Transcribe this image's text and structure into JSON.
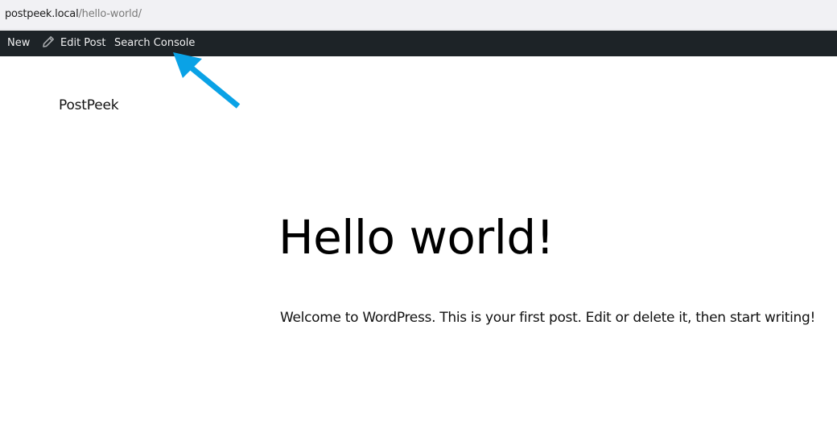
{
  "browser": {
    "url_host": "postpeek.local",
    "url_path": "/hello-world/"
  },
  "admin_bar": {
    "items": [
      {
        "label": "New"
      },
      {
        "label": "Edit Post",
        "icon": "pencil-icon"
      },
      {
        "label": "Search Console"
      }
    ]
  },
  "site": {
    "title": "PostPeek"
  },
  "post": {
    "title": "Hello world!",
    "body": "Welcome to WordPress. This is your first post. Edit or delete it, then start writing!"
  },
  "annotation": {
    "target": "Search Console",
    "color": "#0aa2e6"
  },
  "colors": {
    "admin_bar_bg": "#1d2327",
    "admin_bar_text": "#f0f0f1",
    "address_bar_bg": "#f1f1f4"
  }
}
